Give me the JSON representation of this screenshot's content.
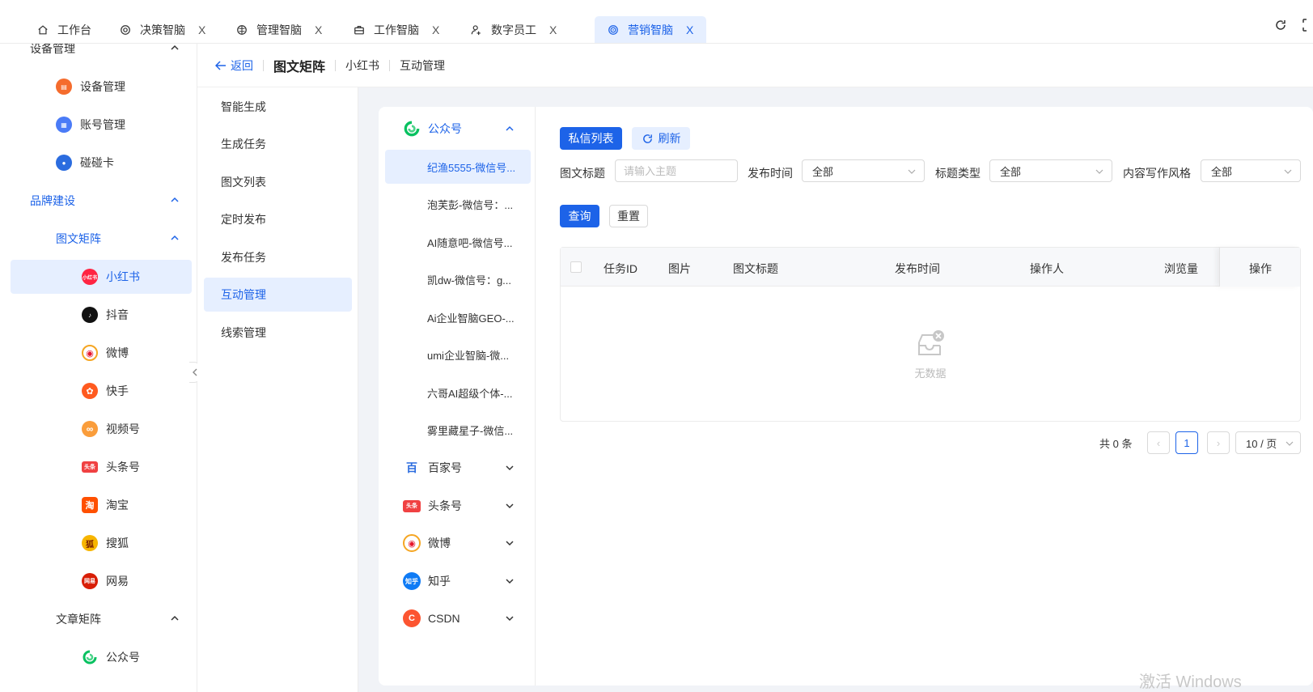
{
  "tabs": [
    {
      "label": "工作台",
      "icon": "home-icon",
      "closable": false
    },
    {
      "label": "决策智脑",
      "icon": "target-icon",
      "closable": true
    },
    {
      "label": "管理智脑",
      "icon": "brain-icon",
      "closable": true
    },
    {
      "label": "工作智脑",
      "icon": "briefcase-icon",
      "closable": true
    },
    {
      "label": "数字员工",
      "icon": "user-add-icon",
      "closable": true
    },
    {
      "label": "营销智脑",
      "icon": "radar-icon",
      "closable": true,
      "active": true
    }
  ],
  "close_glyph": "X",
  "sidebar": {
    "device_group": "设备管理",
    "device_items": [
      {
        "label": "设备管理",
        "icon": "device-icon",
        "color": "#f56c2d"
      },
      {
        "label": "账号管理",
        "icon": "account-icon",
        "color": "#4a7bf7"
      },
      {
        "label": "碰碰卡",
        "icon": "avatar-icon",
        "color": "#2b6cdf"
      }
    ],
    "brand_group": "品牌建设",
    "image_matrix": "图文矩阵",
    "image_items": [
      {
        "label": "小红书",
        "icon": "xiaohongshu-icon",
        "color": "#ff2442",
        "badge": "小红书",
        "selected": true
      },
      {
        "label": "抖音",
        "icon": "douyin-icon",
        "color": "#111111",
        "badge": "♪"
      },
      {
        "label": "微博",
        "icon": "weibo-icon",
        "color": "#e6162d",
        "badge": "◉"
      },
      {
        "label": "快手",
        "icon": "kuaishou-icon",
        "color": "#ff5a1f",
        "badge": "✿"
      },
      {
        "label": "视频号",
        "icon": "channels-icon",
        "color": "#fa9d3b",
        "badge": "∞"
      },
      {
        "label": "头条号",
        "icon": "toutiao-icon",
        "color": "#f04142",
        "badge": "头条"
      },
      {
        "label": "淘宝",
        "icon": "taobao-icon",
        "color": "#ff5000",
        "badge": "淘"
      },
      {
        "label": "搜狐",
        "icon": "sohu-icon",
        "color": "#f7b500",
        "badge": "狐"
      },
      {
        "label": "网易",
        "icon": "netease-icon",
        "color": "#d81e06",
        "badge": "网易"
      }
    ],
    "article_matrix": "文章矩阵",
    "article_items": [
      {
        "label": "公众号",
        "icon": "wechat-official-icon",
        "color": "#07c160"
      }
    ]
  },
  "breadcrumb": {
    "back": "返回",
    "title": "图文矩阵",
    "platform": "小红书",
    "page": "互动管理"
  },
  "submenu": [
    {
      "label": "智能生成"
    },
    {
      "label": "生成任务"
    },
    {
      "label": "图文列表"
    },
    {
      "label": "定时发布"
    },
    {
      "label": "发布任务"
    },
    {
      "label": "互动管理",
      "selected": true
    },
    {
      "label": "线索管理"
    }
  ],
  "platforms": {
    "expanded": {
      "label": "公众号",
      "icon": "wechat-official-icon",
      "color": "#07c160"
    },
    "accounts": [
      {
        "label": "纪渔5555-微信号...",
        "selected": true
      },
      {
        "label": "泡芙彭-微信号：..."
      },
      {
        "label": "AI随意吧-微信号..."
      },
      {
        "label": "凯dw-微信号：g..."
      },
      {
        "label": "Ai企业智脑GEO-..."
      },
      {
        "label": "umi企业智脑-微..."
      },
      {
        "label": "六哥AI超级个体-..."
      },
      {
        "label": "雾里藏星子-微信..."
      }
    ],
    "collapsed": [
      {
        "label": "百家号",
        "icon": "baijiahao-icon",
        "color": "#2b6cdf",
        "badge": "百"
      },
      {
        "label": "头条号",
        "icon": "toutiao-icon",
        "color": "#f04142",
        "badge": "头条"
      },
      {
        "label": "微博",
        "icon": "weibo-icon",
        "color": "#e6162d",
        "badge": "◉"
      },
      {
        "label": "知乎",
        "icon": "zhihu-icon",
        "color": "#0f7bf5",
        "badge": "知乎"
      },
      {
        "label": "CSDN",
        "icon": "csdn-icon",
        "color": "#fc5531",
        "badge": "C"
      }
    ]
  },
  "toolbar": {
    "dm_list": "私信列表",
    "refresh": "刷新"
  },
  "filters": {
    "title_label": "图文标题",
    "title_placeholder": "请输入主题",
    "time_label": "发布时间",
    "time_value": "全部",
    "type_label": "标题类型",
    "type_value": "全部",
    "style_label": "内容写作风格",
    "style_value": "全部",
    "query": "查询",
    "reset": "重置"
  },
  "table": {
    "columns": [
      "任务ID",
      "图片",
      "图文标题",
      "发布时间",
      "操作人",
      "浏览量",
      "操作"
    ],
    "empty": "无数据"
  },
  "pagination": {
    "total": "共 0 条",
    "page": "1",
    "prev": "‹",
    "next": "›",
    "size": "10 / 页"
  },
  "watermark": "激活 Windows",
  "colors": {
    "primary": "#1d63e8",
    "selected_bg": "#e6efff"
  }
}
